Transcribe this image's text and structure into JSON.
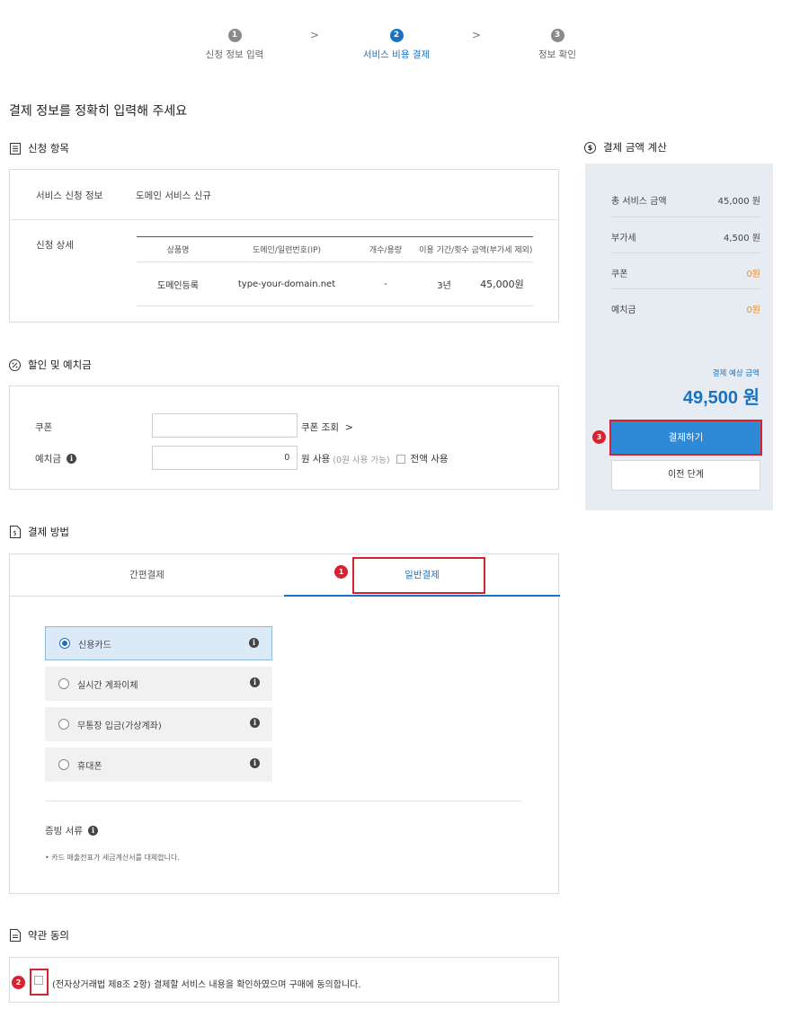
{
  "steps": [
    {
      "num": "1",
      "label": "신청 정보 입력"
    },
    {
      "num": "2",
      "label": "서비스 비용 결제"
    },
    {
      "num": "3",
      "label": "정보 확인"
    }
  ],
  "page_title": "결제 정보를 정확히 입력해 주세요",
  "order": {
    "title": "신청 항목",
    "service_label": "서비스 신청 정보",
    "service_value": "도메인 서비스 신규",
    "detail_label": "신청 상세",
    "table": {
      "headers": [
        "상품명",
        "도메인/일련번호(IP)",
        "개수/용량",
        "이용 기간/횟수",
        "금액(부가세 제외)"
      ],
      "row": [
        "도메인등록",
        "type-your-domain.net",
        "-",
        "3년",
        "45,000원"
      ]
    }
  },
  "discount": {
    "title": "할인 및 예치금",
    "coupon_label": "쿠폰",
    "coupon_value": "",
    "coupon_lookup": "쿠폰 조회",
    "coupon_arrow": ">",
    "deposit_label": "예치금",
    "deposit_value": "0",
    "deposit_use": "원 사용",
    "deposit_available": "(0원 사용 가능)",
    "use_all": "전액 사용"
  },
  "payment": {
    "title": "결제 방법",
    "tabs": [
      "간편결제",
      "일반결제"
    ],
    "methods": [
      "신용카드",
      "실시간 계좌이체",
      "무통장 입금(가상계좌)",
      "휴대폰"
    ],
    "receipt_label": "증빙 서류",
    "receipt_note": "• 카드 매출전표가 세금계산서를 대체합니다."
  },
  "terms": {
    "title": "약관 동의",
    "agree_text": "(전자상거래법 제8조 2항) 결제할 서비스 내용을 확인하였으며 구매에 동의합니다."
  },
  "summary": {
    "title": "결제 금액 계산",
    "rows": [
      {
        "label": "총 서비스 금액",
        "value": "45,000 원"
      },
      {
        "label": "부가세",
        "value": "4,500 원"
      },
      {
        "label": "쿠폰",
        "value": "0원"
      },
      {
        "label": "예치금",
        "value": "0원"
      }
    ],
    "estimate_label": "결제 예상 금액",
    "estimate_amount": "49,500 원",
    "pay_button": "결제하기",
    "prev_button": "이전 단계"
  },
  "callouts": [
    "1",
    "2",
    "3"
  ],
  "colors": {
    "accent": "#1a73c1",
    "highlight": "#d8232f",
    "orange": "#f08a24"
  }
}
